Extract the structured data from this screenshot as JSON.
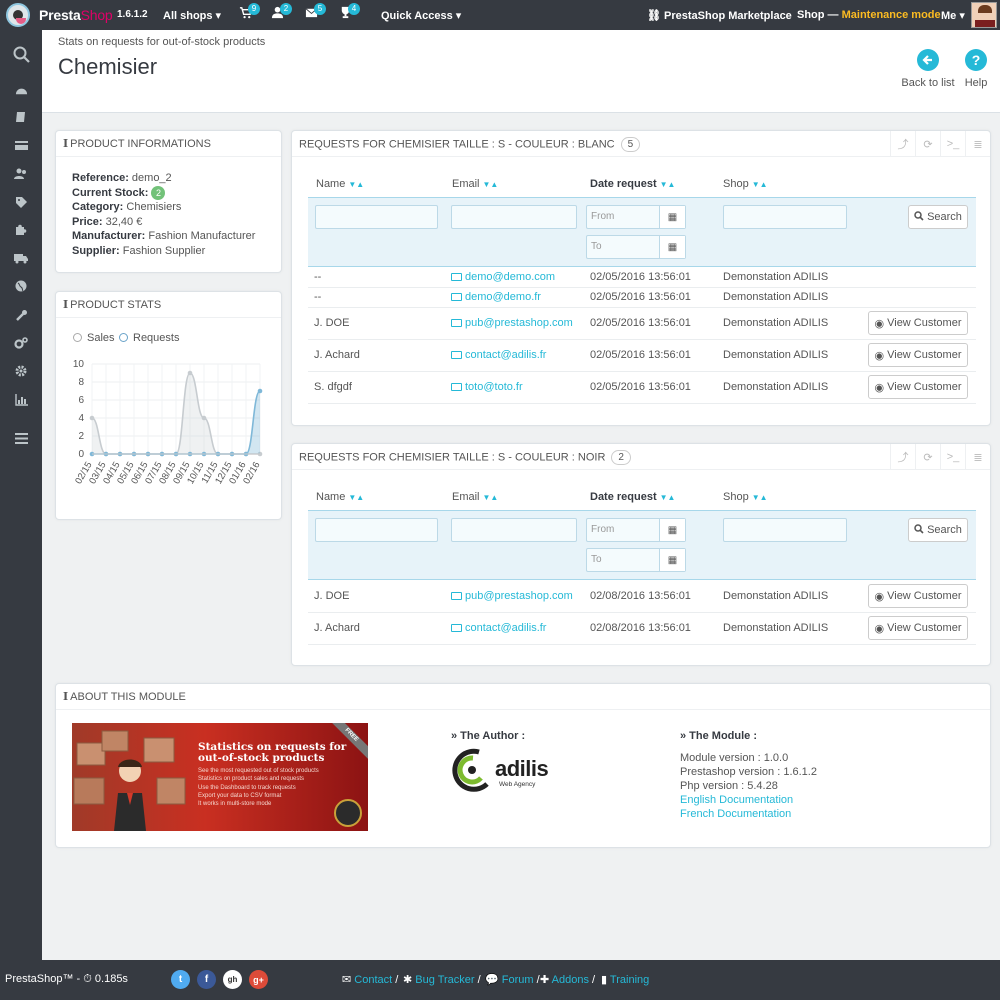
{
  "topbar": {
    "brand_a": "Presta",
    "brand_b": "Shop",
    "version": "1.6.1.2",
    "all_shops": "All shops ▾",
    "badges": [
      "9",
      "2",
      "5",
      "4"
    ],
    "quick_access": "Quick Access ▾",
    "marketplace": "PrestaShop Marketplace",
    "shop": "Shop — ",
    "maintenance": "Maintenance mode",
    "me": "Me ▾"
  },
  "sidebar": {
    "icons": [
      "search-icon",
      "dashboard-icon",
      "catalog-icon",
      "orders-icon",
      "customers-icon",
      "price-rules-icon",
      "modules-icon",
      "shipping-icon",
      "localization-icon",
      "preferences-icon",
      "advanced-params-icon",
      "administration-icon",
      "stats-icon",
      "menu-collapse-icon"
    ]
  },
  "header": {
    "breadcrumb": "Stats on requests for out-of-stock products",
    "title": "Chemisier",
    "back": "Back to list",
    "help": "Help"
  },
  "product_info": {
    "title": "PRODUCT INFORMATIONS",
    "reference_label": "Reference:",
    "reference": " demo_2",
    "stock_label": "Current Stock:",
    "stock": "2",
    "category_label": "Category:",
    "category": " Chemisiers",
    "price_label": "Price:",
    "price": " 32,40 €",
    "manufacturer_label": "Manufacturer:",
    "manufacturer": " Fashion Manufacturer",
    "supplier_label": "Supplier:",
    "supplier": " Fashion Supplier"
  },
  "product_stats": {
    "title": "PRODUCT STATS",
    "legend_sales": "Sales",
    "legend_requests": "Requests"
  },
  "chart_data": {
    "type": "line",
    "x": [
      "02/15",
      "03/15",
      "04/15",
      "05/15",
      "06/15",
      "07/15",
      "08/15",
      "09/15",
      "10/15",
      "11/15",
      "12/15",
      "01/16",
      "02/16"
    ],
    "series": [
      {
        "name": "Sales",
        "values": [
          4,
          0,
          0,
          0,
          0,
          0,
          0,
          9,
          4,
          0,
          0,
          0,
          0
        ]
      },
      {
        "name": "Requests",
        "values": [
          0,
          0,
          0,
          0,
          0,
          0,
          0,
          0,
          0,
          0,
          0,
          0,
          7
        ]
      }
    ],
    "yticks": [
      "0",
      "2",
      "4",
      "6",
      "8",
      "10"
    ],
    "ylim": [
      0,
      10
    ],
    "grid": true
  },
  "columns": {
    "name": "Name",
    "email": "Email",
    "date": "Date request",
    "shop": "Shop",
    "from_placeholder": "From",
    "to_placeholder": "To",
    "search": "Search",
    "view_customer": "View Customer"
  },
  "table1": {
    "title": "REQUESTS FOR CHEMISIER TAILLE : S - COULEUR : BLANC",
    "count": "5",
    "rows": [
      {
        "name": "--",
        "email": "demo@demo.com",
        "date": "02/05/2016 13:56:01",
        "shop": "Demonstation ADILIS"
      },
      {
        "name": "--",
        "email": "demo@demo.fr",
        "date": "02/05/2016 13:56:01",
        "shop": "Demonstation ADILIS"
      },
      {
        "name": "J. DOE",
        "email": "pub@prestashop.com",
        "date": "02/05/2016 13:56:01",
        "shop": "Demonstation ADILIS"
      },
      {
        "name": "J. Achard",
        "email": "contact@adilis.fr",
        "date": "02/05/2016 13:56:01",
        "shop": "Demonstation ADILIS"
      },
      {
        "name": "S. dfgdf",
        "email": "toto@toto.fr",
        "date": "02/05/2016 13:56:01",
        "shop": "Demonstation ADILIS"
      }
    ]
  },
  "table2": {
    "title": "REQUESTS FOR CHEMISIER TAILLE : S - COULEUR : NOIR",
    "count": "2",
    "rows": [
      {
        "name": "J. DOE",
        "email": "pub@prestashop.com",
        "date": "02/08/2016 13:56:01",
        "shop": "Demonstation ADILIS"
      },
      {
        "name": "J. Achard",
        "email": "contact@adilis.fr",
        "date": "02/08/2016 13:56:01",
        "shop": "Demonstation ADILIS"
      }
    ]
  },
  "about": {
    "title": "ABOUT THIS MODULE",
    "banner_title": "Statistics on requests for out-of-stock products",
    "banner_lines": [
      "See the most requested out of stock products",
      "Statistics on product sales and requests",
      "Use the Dashboard to track requests",
      "Export your data to CSV format",
      "It works in multi-store mode"
    ],
    "banner_ribbon": "FREE",
    "author_head": "» The Author :",
    "adilis": "adilis",
    "adilis_sub": "Web Agency",
    "module_head": "» The Module :",
    "module_version": "Module version : 1.0.0",
    "prestashop_version": "Prestashop version : 1.6.1.2",
    "php_version": "Php version : 5.4.28",
    "english_doc": "English Documentation",
    "french_doc": "French Documentation"
  },
  "footer": {
    "brand": "PrestaShop™ - ",
    "time": "0.185s",
    "social": [
      "t",
      "f",
      "gh",
      "g+"
    ],
    "contact": "Contact",
    "bug": "Bug Tracker",
    "forum": "Forum",
    "addons": "Addons",
    "training": "Training",
    "sep": " /"
  },
  "colors": {
    "accent": "#25b9d7",
    "topbar": "#363a41",
    "maintenance": "#fbbb22",
    "brand_pink": "#df0067",
    "badge_green": "#72c279"
  }
}
